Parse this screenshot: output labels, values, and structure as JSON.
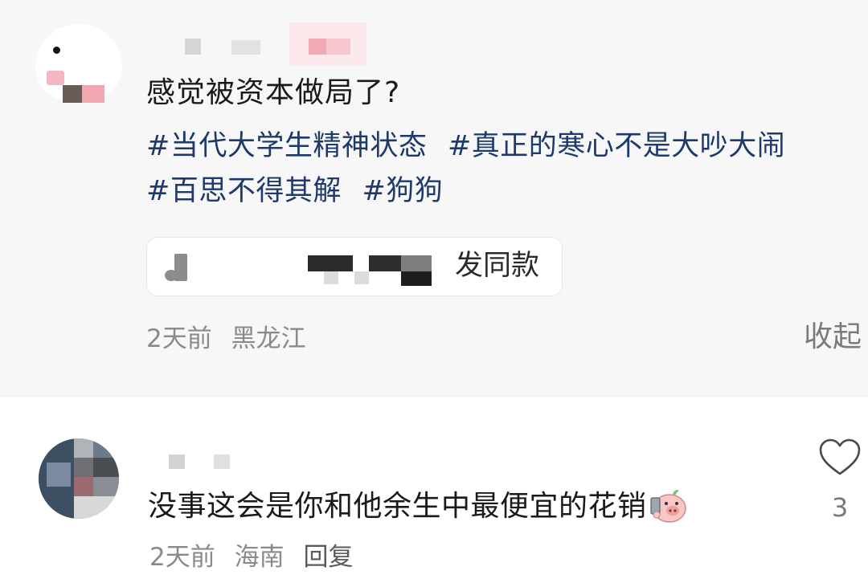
{
  "post": {
    "text": "感觉被资本做局了?",
    "tags": [
      "#当代大学生精神状态",
      "#真正的寒心不是大吵大闹",
      "#百思不得其解",
      "#狗狗"
    ],
    "music_card": {
      "label": "发同款",
      "icon": "music-note-icon"
    },
    "time": "2天前",
    "location": "黑龙江",
    "collapse_label": "收起"
  },
  "reply": {
    "text": "没事这会是你和他余生中最便宜的花销",
    "emoji": "pig-phone-emoji-icon",
    "time": "2天前",
    "location": "海南",
    "reply_label": "回复",
    "like_icon": "heart-icon",
    "like_count": "3"
  },
  "colors": {
    "hashtag": "#1d3a6b",
    "meta_text": "#8a8a8a",
    "post_background": "#f7f7f7"
  }
}
